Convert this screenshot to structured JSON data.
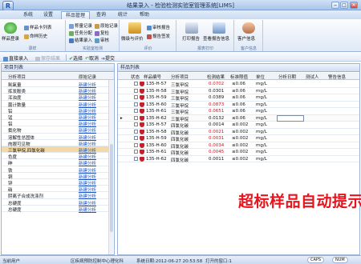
{
  "window": {
    "title": "结果录入 - 检验检测实验室管理系统[LIMS]",
    "logo_text": "R"
  },
  "menu": [
    "系统",
    "设置",
    "样品管理",
    "查询",
    "统计",
    "帮助"
  ],
  "ribbon": {
    "groups": [
      "录样",
      "实验室检测",
      "评价",
      "报表打印",
      "客户信息"
    ],
    "sample_register": "样品登录",
    "sample_card": "样品卡列表",
    "sample_history": "命样历史",
    "weigh_record": "称量记录",
    "task_assign": "任务分配",
    "result_entry": "结果录入",
    "raw_record": "原始记录",
    "reinspect": "复检",
    "review": "审核",
    "grade_eval": "微级与评价",
    "audit_report": "审核报告",
    "report_issue": "报告签发",
    "print_report": "打印报告",
    "view_report_info": "查看报告信息",
    "customer_info": "客户信息"
  },
  "toolbar": {
    "batch_entry": "直接录入",
    "save": "保存结果",
    "select": "选择",
    "cancel": "取消",
    "submit": "提交"
  },
  "left_panel": {
    "title": "项目列表",
    "col_item": "分析项目",
    "col_record": "原始记录",
    "link_text": "新建分析",
    "items": [
      "耗氧量",
      "挥发酚类",
      "浑浊度",
      "菌计数量",
      "铅",
      "锰",
      "铝",
      "氟化物",
      "溶解性总固体",
      "肉眼可见物",
      "三氯甲烷,四氯化碳",
      "色度",
      "砷",
      "铁",
      "铜",
      "锌",
      "硝",
      "阴离子合成洗涤剂",
      "总硬度",
      "总硬度"
    ],
    "selected_index": 10
  },
  "right_panel": {
    "title": "样品列表",
    "columns": [
      "状态",
      "样品编号",
      "分析项目",
      "检测结果",
      "标准限值",
      "单位",
      "分析日期",
      "测试人",
      "警告信息"
    ],
    "rows": [
      {
        "id": "135-H-57",
        "item": "三氯甲烷",
        "result": "0.0702",
        "limit": "≤0.06",
        "unit": "mg/L",
        "over": true
      },
      {
        "id": "135-H-58",
        "item": "三氯甲烷",
        "result": "0.0301",
        "limit": "≤0.06",
        "unit": "mg/L",
        "over": false
      },
      {
        "id": "135-H-59",
        "item": "三氯甲烷",
        "result": "0.0389",
        "limit": "≤0.06",
        "unit": "mg/L",
        "over": false
      },
      {
        "id": "135-H-60",
        "item": "三氯甲烷",
        "result": "0.0873",
        "limit": "≤0.06",
        "unit": "mg/L",
        "over": true
      },
      {
        "id": "135-H-61",
        "item": "三氯甲烷",
        "result": "0.0651",
        "limit": "≤0.06",
        "unit": "mg/L",
        "over": true
      },
      {
        "id": "135-H-62",
        "item": "三氯甲烷",
        "result": "0.0132",
        "limit": "≤0.06",
        "unit": "mg/L",
        "over": false
      },
      {
        "id": "135-H-57",
        "item": "四氯化碳",
        "result": "0.0014",
        "limit": "≤0.002",
        "unit": "mg/L",
        "over": false
      },
      {
        "id": "135-H-58",
        "item": "四氯化碳",
        "result": "0.0021",
        "limit": "≤0.002",
        "unit": "mg/L",
        "over": true
      },
      {
        "id": "135-H-59",
        "item": "四氯化碳",
        "result": "0.0031",
        "limit": "≤0.002",
        "unit": "mg/L",
        "over": true
      },
      {
        "id": "135-H-60",
        "item": "四氯化碳",
        "result": "0.0034",
        "limit": "≤0.002",
        "unit": "mg/L",
        "over": true
      },
      {
        "id": "135-H-61",
        "item": "四氯化碳",
        "result": "0.0045",
        "limit": "≤0.002",
        "unit": "mg/L",
        "over": true
      },
      {
        "id": "135-H-62",
        "item": "四氯化碳",
        "result": "0.0011",
        "limit": "≤0.002",
        "unit": "mg/L",
        "over": false
      }
    ],
    "current_row": 5
  },
  "banner": "超标样品自动提示",
  "status": {
    "user_label": "当前用户",
    "org": "区疾病预防控制中心理化科",
    "time": "系统日期:2012-06-27 20:53:58",
    "window": "打开的窗口:1",
    "caps": "CAPS",
    "num": "NUM"
  },
  "colors": {
    "over_limit": "#d0101c",
    "banner": "#e8141d",
    "link": "#1a52c4"
  }
}
